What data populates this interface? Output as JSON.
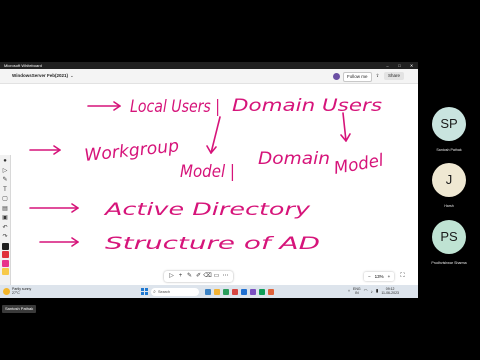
{
  "window": {
    "title": "Microsoft Whiteboard"
  },
  "appbar": {
    "board_name": "WindowsServer Feb(2021)",
    "follow_me": "Follow me",
    "share": "Share"
  },
  "whiteboard": {
    "ink_color": "#d6147a",
    "lines": {
      "local_users": "Local Users |",
      "domain_users": "Domain Users",
      "workgroup": "Workgroup",
      "workgroup_model": "Model |",
      "domain": "Domain",
      "domain_model": "Model",
      "active_directory": "Active Directory",
      "structure": "Structure of AD"
    }
  },
  "left_toolbar": {
    "icons": [
      "dot-icon",
      "select-icon",
      "pen-icon",
      "text-icon",
      "shape-icon",
      "note-icon",
      "image-icon",
      "undo-icon",
      "redo-icon"
    ],
    "pen_colors": [
      "#1e1e1e",
      "#e0303a",
      "#e8338c",
      "#f7c948"
    ]
  },
  "canvas_toolbar": {
    "icons": [
      "select-icon",
      "add-icon",
      "pen-icon",
      "highlighter-icon",
      "eraser-icon",
      "ruler-icon",
      "more-icon"
    ],
    "zoom": "13%"
  },
  "taskbar": {
    "weather_line1": "Partly sunny",
    "weather_line2": "27°C",
    "search_placeholder": "Search",
    "app_colors": [
      "#3b82c4",
      "#f2b233",
      "#2a9d5c",
      "#d64541",
      "#1f6fd1",
      "#7a4fc0",
      "#0f9d58",
      "#e0623a"
    ],
    "lang1": "ENG",
    "lang2": "IN",
    "time": "09:12",
    "date": "11-06-2023"
  },
  "participants": [
    {
      "initials": "SP",
      "name": "Santosh Pathak",
      "color": "#c9e4df"
    },
    {
      "initials": "J",
      "name": "Harsh",
      "color": "#efe8d2"
    },
    {
      "initials": "PS",
      "name": "Prudhvishwar Sharma",
      "color": "#bfe3d3"
    }
  ],
  "presenter_label": "Santosh Pathak"
}
